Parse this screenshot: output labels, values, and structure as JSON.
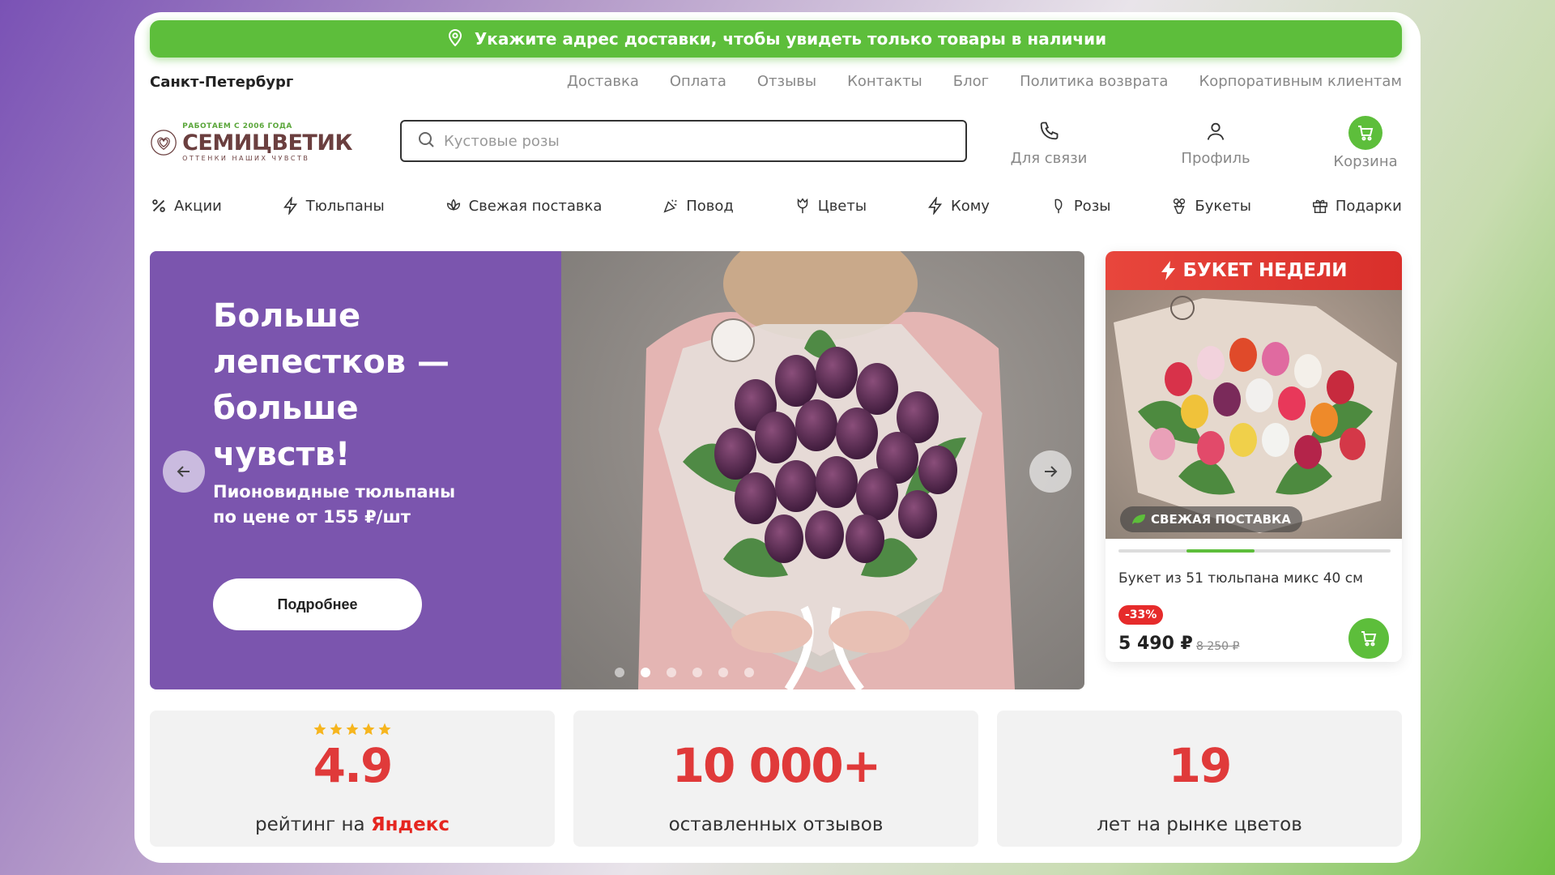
{
  "banner": {
    "text": "Укажите адрес доставки, чтобы увидеть только товары в наличии"
  },
  "city": "Санкт-Петербург",
  "topnav": [
    "Доставка",
    "Оплата",
    "Отзывы",
    "Контакты",
    "Блог",
    "Политика возврата",
    "Корпоративным клиентам"
  ],
  "logo": {
    "since": "РАБОТАЕМ С 2006 ГОДА",
    "name": "СЕМИЦВЕТИК",
    "tagline": "ОТТЕНКИ НАШИХ ЧУВСТВ"
  },
  "search": {
    "placeholder": "Кустовые розы"
  },
  "header_icons": {
    "contact": "Для связи",
    "profile": "Профиль",
    "cart": "Корзина"
  },
  "categories": [
    "Акции",
    "Тюльпаны",
    "Свежая поставка",
    "Повод",
    "Цветы",
    "Кому",
    "Розы",
    "Букеты",
    "Подарки"
  ],
  "hero": {
    "title": "Больше лепестков — больше чувств!",
    "subtitle": "Пионовидные тюльпаны по цене от 155 ₽/шт",
    "button": "Подробнее",
    "slides_count": 6,
    "active_slide": 1,
    "bg_color": "#7b55ae"
  },
  "week_bouquet": {
    "header": "БУКЕТ НЕДЕЛИ",
    "badge": "СВЕЖАЯ ПОСТАВКА",
    "name": "Букет из 51 тюльпана микс 40 см",
    "discount": "-33%",
    "price": "5 490 ₽",
    "old_price": "8 250 ₽",
    "carousel_progress": {
      "start": 0.25,
      "end": 0.5
    }
  },
  "stats": [
    {
      "value": "4.9",
      "label_prefix": "рейтинг на ",
      "label_brand": "Яндекс",
      "stars": 5
    },
    {
      "value": "10 000+",
      "label": "оставленных отзывов"
    },
    {
      "value": "19",
      "label": "лет на рынке цветов"
    }
  ],
  "colors": {
    "green": "#5dbe3b",
    "purple": "#7b55ae",
    "red": "#e03a3a"
  }
}
